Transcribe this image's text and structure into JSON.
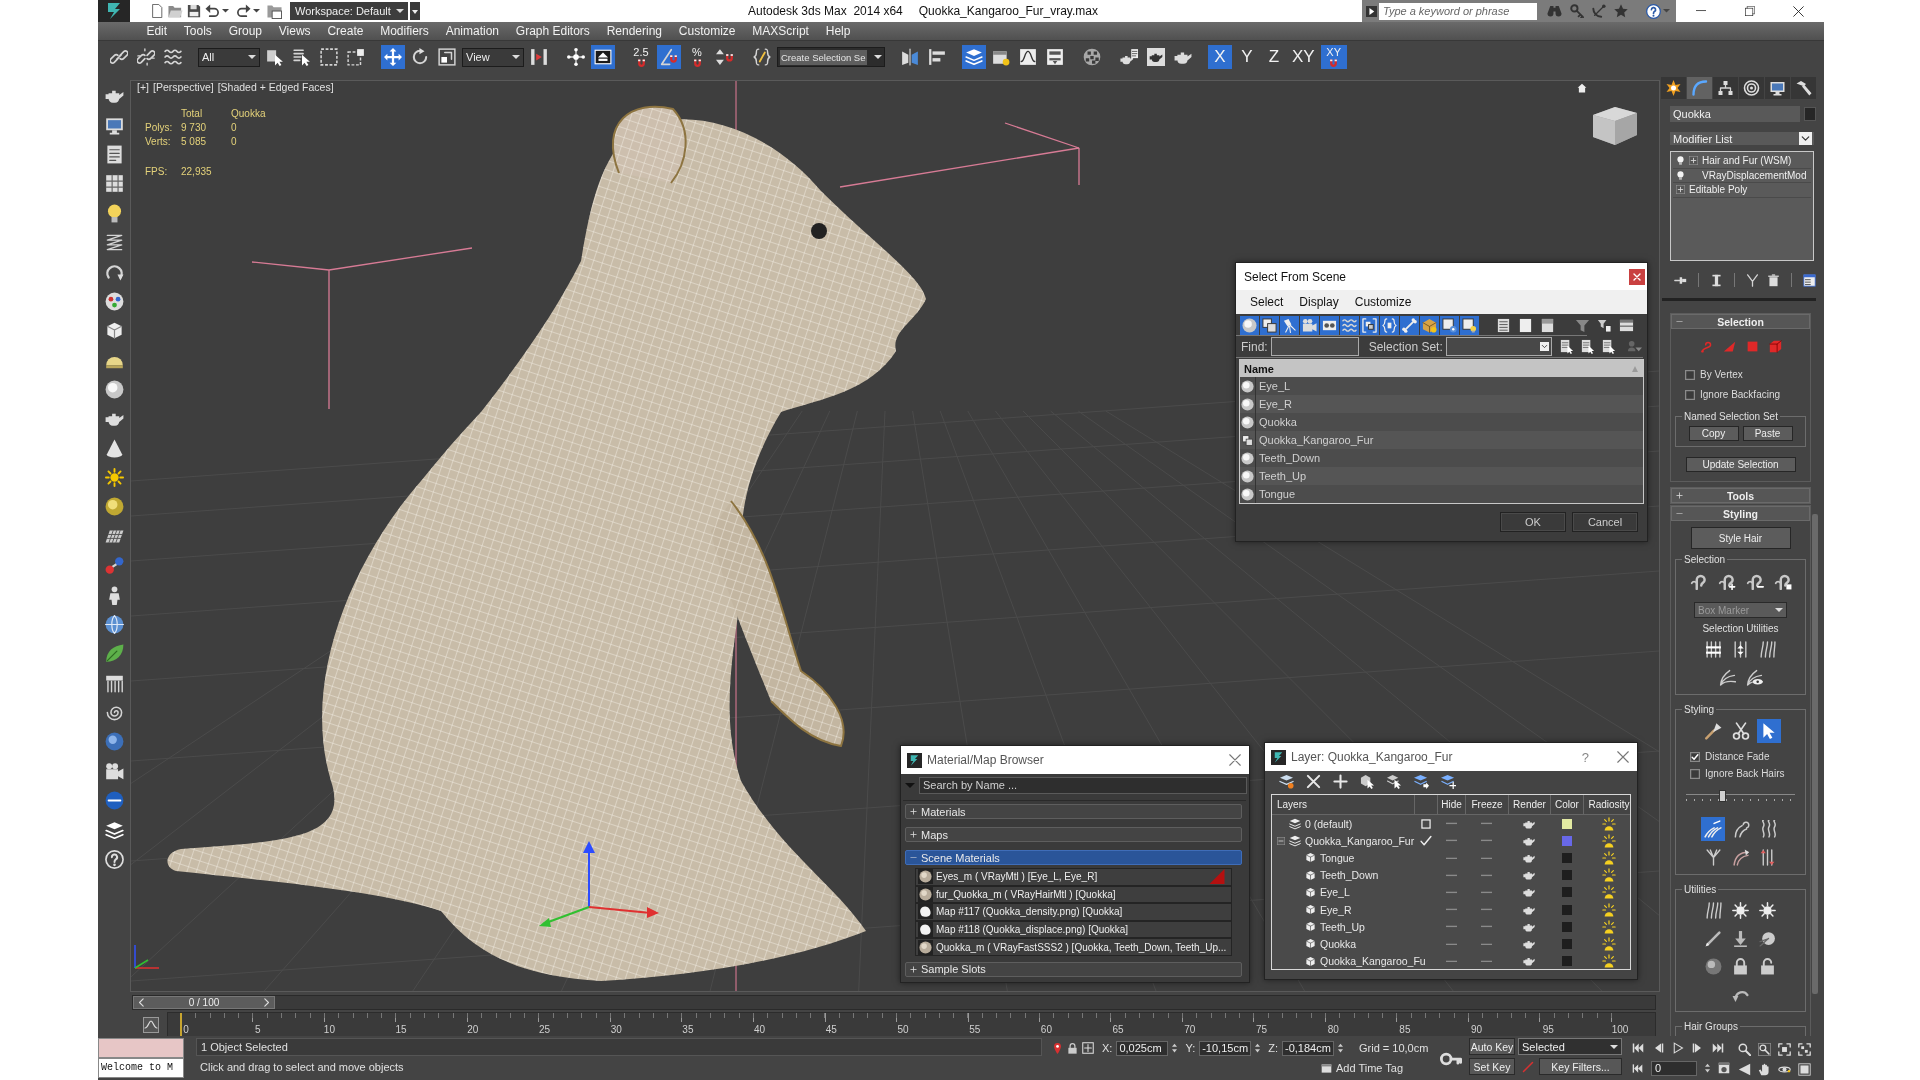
{
  "title_bar": {
    "workspace": "Workspace: Default",
    "app_title": "Autodesk 3ds Max  2014 x64",
    "file_name": "Quokka_Kangaroo_Fur_vray.max",
    "search_placeholder": "Type a keyword or phrase"
  },
  "menu_bar": [
    "Edit",
    "Tools",
    "Group",
    "Views",
    "Create",
    "Modifiers",
    "Animation",
    "Graph Editors",
    "Rendering",
    "Customize",
    "MAXScript",
    "Help"
  ],
  "main_toolbar": {
    "groups": [
      [
        {
          "kind": "icon",
          "selected": false
        },
        {
          "kind": "icon",
          "selected": false
        },
        {
          "kind": "icon",
          "selected": false
        }
      ],
      [
        {
          "kind": "dropdown",
          "value": "All"
        },
        {
          "kind": "icon",
          "selected": false
        },
        {
          "kind": "icon",
          "selected": false
        },
        {
          "kind": "icon",
          "selected": false
        },
        {
          "kind": "icon",
          "selected": false
        }
      ],
      [
        {
          "kind": "icon",
          "selected": true
        },
        {
          "kind": "icon",
          "selected": false
        },
        {
          "kind": "icon",
          "selected": false
        },
        {
          "kind": "dropdown",
          "value": "View"
        },
        {
          "kind": "icon",
          "selected": false
        }
      ],
      [
        {
          "kind": "icon",
          "selected": false
        },
        {
          "kind": "icon",
          "selected": true
        }
      ],
      [
        {
          "kind": "snap",
          "label": "2.5",
          "selected": false
        },
        {
          "kind": "icon",
          "selected": true
        },
        {
          "kind": "snap",
          "label": "%",
          "selected": false
        },
        {
          "kind": "icon",
          "selected": false
        }
      ],
      [
        {
          "kind": "icon",
          "selected": false
        },
        {
          "kind": "combo",
          "value": "Create Selection Se"
        }
      ],
      [
        {
          "kind": "icon",
          "selected": false
        },
        {
          "kind": "icon",
          "selected": false
        }
      ],
      [
        {
          "kind": "icon",
          "selected": true
        },
        {
          "kind": "icon",
          "selected": false
        },
        {
          "kind": "icon",
          "selected": false
        },
        {
          "kind": "icon",
          "selected": false
        }
      ],
      [
        {
          "kind": "icon",
          "selected": false
        }
      ],
      [
        {
          "kind": "icon",
          "selected": false
        },
        {
          "kind": "icon",
          "selected": false
        },
        {
          "kind": "icon",
          "selected": false
        }
      ],
      [
        {
          "kind": "text",
          "label": "X",
          "selected": true
        },
        {
          "kind": "text",
          "label": "Y",
          "selected": false
        },
        {
          "kind": "text",
          "label": "Z",
          "selected": false
        },
        {
          "kind": "text",
          "label": "XY",
          "selected": false
        },
        {
          "kind": "snap",
          "label": "XY",
          "selected": true
        }
      ]
    ]
  },
  "viewport": {
    "labels": [
      "[+]",
      "[Perspective]",
      "[Shaded + Edged Faces]"
    ],
    "stats": {
      "columns": [
        "Total",
        "Quokka"
      ],
      "rows": [
        {
          "label": "Polys:",
          "values": [
            "9 730",
            "0"
          ]
        },
        {
          "label": "Verts:",
          "values": [
            "5 085",
            "0"
          ]
        }
      ],
      "fps_label": "FPS:",
      "fps": "22,935"
    }
  },
  "select_from_scene": {
    "title": "Select From Scene",
    "menus": [
      "Select",
      "Display",
      "Customize"
    ],
    "filters": [
      {
        "selected": true
      },
      {
        "selected": true
      },
      {
        "selected": true
      },
      {
        "selected": true
      },
      {
        "selected": true
      },
      {
        "selected": true
      },
      {
        "selected": true
      },
      {
        "selected": true
      },
      {
        "selected": true
      },
      {
        "selected": true
      },
      {
        "selected": true
      },
      {
        "selected": true
      }
    ],
    "find_label": "Find:",
    "selection_set_label": "Selection Set:",
    "column": "Name",
    "rows": [
      {
        "name": "Eye_L",
        "kind": "geometry",
        "selected": false
      },
      {
        "name": "Eye_R",
        "kind": "geometry",
        "selected": false
      },
      {
        "name": "Quokka",
        "kind": "geometry",
        "selected": false
      },
      {
        "name": "Quokka_Kangaroo_Fur",
        "kind": "hair",
        "selected": false
      },
      {
        "name": "Teeth_Down",
        "kind": "geometry",
        "selected": false
      },
      {
        "name": "Teeth_Up",
        "kind": "geometry",
        "selected": false
      },
      {
        "name": "Tongue",
        "kind": "geometry",
        "selected": false
      }
    ],
    "buttons": [
      "OK",
      "Cancel"
    ]
  },
  "material_browser": {
    "title": "Material/Map Browser",
    "search_placeholder": "Search by Name ...",
    "groups": [
      {
        "label": "Materials",
        "expanded": false,
        "selected": false
      },
      {
        "label": "Maps",
        "expanded": false,
        "selected": false
      },
      {
        "label": "Scene Materials",
        "expanded": true,
        "selected": true,
        "items": [
          {
            "name": "Eyes_m ( VRayMtl ) [Eye_L, Eye_R]",
            "kind": "material",
            "flag": true
          },
          {
            "name": "fur_Quokka_m ( VRayHairMtl ) [Quokka]",
            "kind": "material",
            "flag": false
          },
          {
            "name": "Map #117 (Quokka_density.png) [Quokka]",
            "kind": "map",
            "flag": false
          },
          {
            "name": "Map #118 (Quokka_displace.png) [Quokka]",
            "kind": "map",
            "flag": false
          },
          {
            "name": "Quokka_m ( VRayFastSSS2 ) [Quokka, Teeth_Down, Teeth_Up...",
            "kind": "material",
            "flag": false
          }
        ]
      },
      {
        "label": "Sample Slots",
        "expanded": false,
        "selected": false
      }
    ]
  },
  "layer_dialog": {
    "title": "Layer: Quokka_Kangaroo_Fur",
    "help": "?",
    "columns": [
      "Layers",
      "Hide",
      "Freeze",
      "Render",
      "Color",
      "Radiosity"
    ],
    "layers": [
      {
        "name": "0 (default)",
        "selected": false,
        "current": false,
        "hidden": false,
        "frozen": false,
        "renderable": true,
        "color": "#e2eaa2",
        "radiosity": true
      },
      {
        "name": "Quokka_Kangaroo_Fur",
        "selected": false,
        "current": true,
        "expanded": true,
        "hidden": false,
        "frozen": false,
        "renderable": true,
        "color": "#6868e8",
        "radiosity": true,
        "children": [
          {
            "name": "Tongue",
            "selected": false,
            "hidden": false,
            "frozen": false,
            "renderable": true,
            "color": "#1e1e1e",
            "radiosity": true
          },
          {
            "name": "Teeth_Down",
            "selected": false,
            "hidden": false,
            "frozen": false,
            "renderable": true,
            "color": "#1e1e1e",
            "radiosity": true
          },
          {
            "name": "Eye_L",
            "selected": false,
            "hidden": false,
            "frozen": false,
            "renderable": true,
            "color": "#1e1e1e",
            "radiosity": true
          },
          {
            "name": "Eye_R",
            "selected": false,
            "hidden": false,
            "frozen": false,
            "renderable": true,
            "color": "#1e1e1e",
            "radiosity": true
          },
          {
            "name": "Teeth_Up",
            "selected": false,
            "hidden": false,
            "frozen": false,
            "renderable": true,
            "color": "#1e1e1e",
            "radiosity": true
          },
          {
            "name": "Quokka",
            "selected": false,
            "hidden": false,
            "frozen": false,
            "renderable": true,
            "color": "#1e1e1e",
            "radiosity": true
          },
          {
            "name": "Quokka_Kangaroo_Fu",
            "selected": false,
            "hidden": false,
            "frozen": false,
            "renderable": true,
            "color": "#1e1e1e",
            "radiosity": true
          }
        ]
      }
    ]
  },
  "command_panel": {
    "tabs": [
      {
        "selected": false
      },
      {
        "selected": true
      },
      {
        "selected": false
      },
      {
        "selected": false
      },
      {
        "selected": false
      },
      {
        "selected": false
      }
    ],
    "object_name": "Quokka",
    "modifier_list": "Modifier List",
    "stack": [
      {
        "name": "Hair and Fur (WSM)",
        "kind": "modifier",
        "on": true,
        "expanded": false,
        "selected": false
      },
      {
        "name": "VRayDisplacementMod",
        "kind": "modifier",
        "on": true,
        "selected": false
      },
      {
        "name": "Editable Poly",
        "kind": "base",
        "expanded": false,
        "selected": false
      }
    ],
    "rollouts": [
      {
        "title": "Selection",
        "expanded": true,
        "controls": [
          {
            "kind": "icons",
            "buttons": [
              {
                "selected": false
              },
              {
                "selected": false
              },
              {
                "selected": false
              },
              {
                "selected": false
              }
            ]
          },
          {
            "kind": "checkbox",
            "label": "By Vertex",
            "checked": false
          },
          {
            "kind": "checkbox",
            "label": "Ignore Backfacing",
            "checked": false
          },
          {
            "kind": "group",
            "title": "Named Selection Set",
            "controls": [
              {
                "kind": "buttons",
                "labels": [
                  "Copy",
                  "Paste"
                ]
              }
            ]
          },
          {
            "kind": "button",
            "label": "Update Selection"
          }
        ]
      },
      {
        "title": "Tools",
        "expanded": false
      },
      {
        "title": "Styling",
        "expanded": true,
        "controls": [
          {
            "kind": "button",
            "label": "Style Hair"
          },
          {
            "kind": "group",
            "title": "Selection",
            "controls": [
              {
                "kind": "icons",
                "buttons": [
                  {
                    "selected": false
                  },
                  {
                    "selected": false
                  },
                  {
                    "selected": false
                  },
                  {
                    "selected": false
                  }
                ]
              },
              {
                "kind": "dropdown",
                "value": "Box Marker",
                "disabled": true
              },
              {
                "kind": "label",
                "text": "Selection Utilities"
              },
              {
                "kind": "icons",
                "buttons": [
                  {
                    "selected": false
                  },
                  {
                    "selected": false
                  },
                  {
                    "selected": false
                  }
                ]
              },
              {
                "kind": "icons",
                "buttons": [
                  {
                    "selected": false
                  },
                  {
                    "selected": false
                  }
                ]
              }
            ]
          },
          {
            "kind": "group",
            "title": "Styling",
            "controls": [
              {
                "kind": "icons",
                "buttons": [
                  {
                    "selected": false
                  },
                  {
                    "selected": false
                  },
                  {
                    "selected": true
                  }
                ]
              },
              {
                "kind": "checkbox",
                "label": "Distance Fade",
                "checked": true
              },
              {
                "kind": "checkbox",
                "label": "Ignore Back Hairs",
                "checked": false
              },
              {
                "kind": "slider",
                "level": 0.32
              },
              {
                "kind": "icons",
                "buttons": [
                  {
                    "selected": true
                  },
                  {
                    "selected": false
                  },
                  {
                    "selected": false
                  }
                ]
              },
              {
                "kind": "icons",
                "buttons": [
                  {
                    "selected": false
                  },
                  {
                    "selected": false
                  },
                  {
                    "selected": false
                  }
                ]
              }
            ]
          },
          {
            "kind": "group",
            "title": "Utilities",
            "controls": [
              {
                "kind": "icons",
                "buttons": [
                  {
                    "selected": false
                  },
                  {
                    "selected": false
                  },
                  {
                    "selected": false
                  }
                ]
              },
              {
                "kind": "icons",
                "buttons": [
                  {
                    "selected": false
                  },
                  {
                    "selected": false
                  },
                  {
                    "selected": false
                  }
                ]
              },
              {
                "kind": "icons",
                "buttons": [
                  {
                    "selected": false
                  },
                  {
                    "selected": false
                  },
                  {
                    "selected": false
                  }
                ]
              },
              {
                "kind": "icons",
                "buttons": [
                  {
                    "selected": false
                  }
                ]
              }
            ]
          },
          {
            "kind": "group",
            "title": "Hair Groups"
          }
        ]
      }
    ]
  },
  "time_slider": {
    "label": "0 / 100",
    "level": 0
  },
  "track_bar": {
    "labels": [
      "0",
      "5",
      "10",
      "15",
      "20",
      "25",
      "30",
      "35",
      "40",
      "45",
      "50",
      "55",
      "60",
      "65",
      "70",
      "75",
      "80",
      "85",
      "90",
      "95",
      "100"
    ]
  },
  "status_bar": {
    "listener_output": "Welcome to M",
    "selection": "1 Object Selected",
    "prompt": "Click and drag to select and move objects",
    "coordinates": [
      {
        "axis": "X:",
        "value": "0,025cm"
      },
      {
        "axis": "Y:",
        "value": "-10,15cm"
      },
      {
        "axis": "Z:",
        "value": "-0,184cm"
      }
    ],
    "grid": "Grid = 10,0cm",
    "time_tag": "Add Time Tag",
    "auto_key": {
      "label": "Auto Key",
      "on": false
    },
    "key_mode": "Selected",
    "set_key": "Set Key",
    "key_filters": "Key Filters...",
    "frame": "0"
  }
}
